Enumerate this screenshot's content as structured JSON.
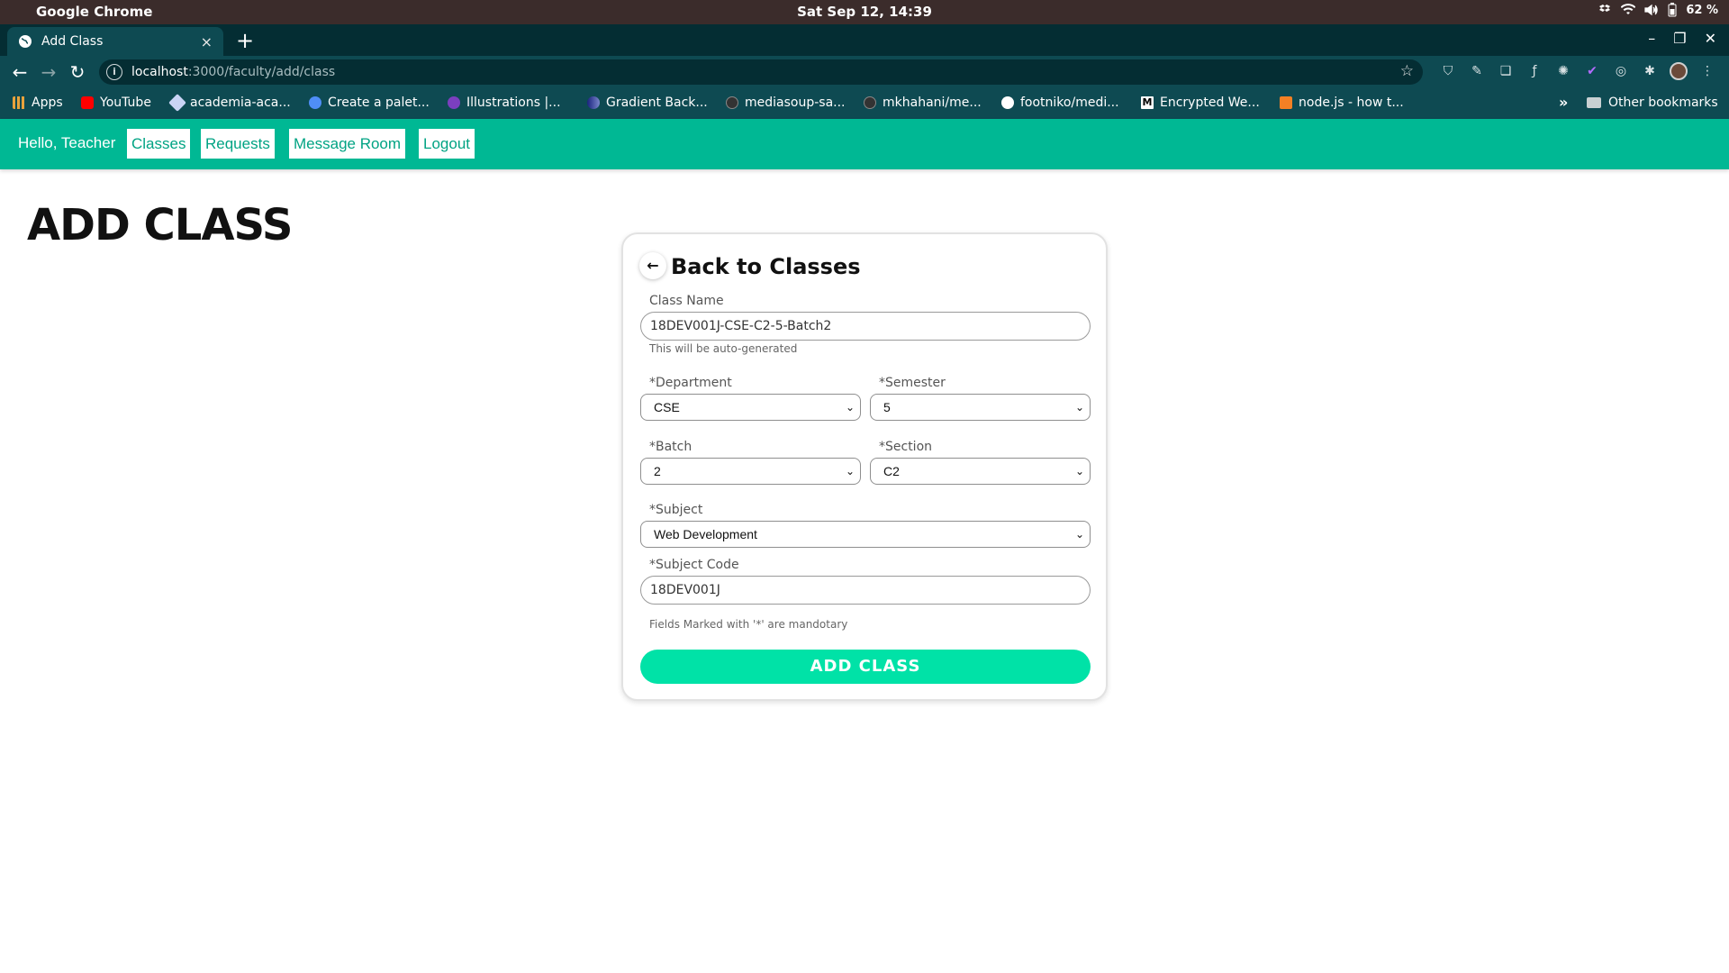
{
  "os": {
    "app_name": "Google Chrome",
    "clock": "Sat Sep 12, 14:39",
    "battery": "62 %"
  },
  "browser": {
    "tab_title": "Add Class",
    "tab_close": "×",
    "new_tab": "+",
    "url_host": "localhost",
    "url_path": ":3000/faculty/add/class",
    "bookmarks": [
      {
        "label": "Apps",
        "color": "#e8a33c"
      },
      {
        "label": "YouTube",
        "color": "#ff0000"
      },
      {
        "label": "academia-aca...",
        "color": "#c9d4f5"
      },
      {
        "label": "Create a palet...",
        "color": "#4f8ef7"
      },
      {
        "label": "Illustrations |...",
        "color": "#7b3fbf"
      },
      {
        "label": "Gradient Back...",
        "color": "#3949ab"
      },
      {
        "label": "mediasoup-sa...",
        "color": "#333333"
      },
      {
        "label": "mkhahani/me...",
        "color": "#333333"
      },
      {
        "label": "footniko/medi...",
        "color": "#ffffff"
      },
      {
        "label": "Encrypted We...",
        "color": "#000000"
      },
      {
        "label": "node.js - how t...",
        "color": "#f48024"
      }
    ],
    "bookmarks_more": "»",
    "other_bookmarks": "Other bookmarks"
  },
  "navbar": {
    "greeting": "Hello, Teacher",
    "links": [
      "Classes",
      "Requests",
      "Message Room",
      "Logout"
    ],
    "accent": "#00b894"
  },
  "page": {
    "title": "ADD CLASS"
  },
  "form": {
    "back_label": "Back to Classes",
    "class_name_label": "Class Name",
    "class_name_value": "18DEV001J-CSE-C2-5-Batch2",
    "class_name_hint": "This will be auto-generated",
    "department_label": "*Department",
    "department_value": "CSE",
    "semester_label": "*Semester",
    "semester_value": "5",
    "batch_label": "*Batch",
    "batch_value": "2",
    "section_label": "*Section",
    "section_value": "C2",
    "subject_label": "*Subject",
    "subject_value": "Web Development",
    "subject_code_label": "*Subject Code",
    "subject_code_value": "18DEV001J",
    "mandatory_note": "Fields Marked with '*' are mandotary",
    "submit_label": "ADD CLASS",
    "submit_color": "#00e2a7"
  }
}
